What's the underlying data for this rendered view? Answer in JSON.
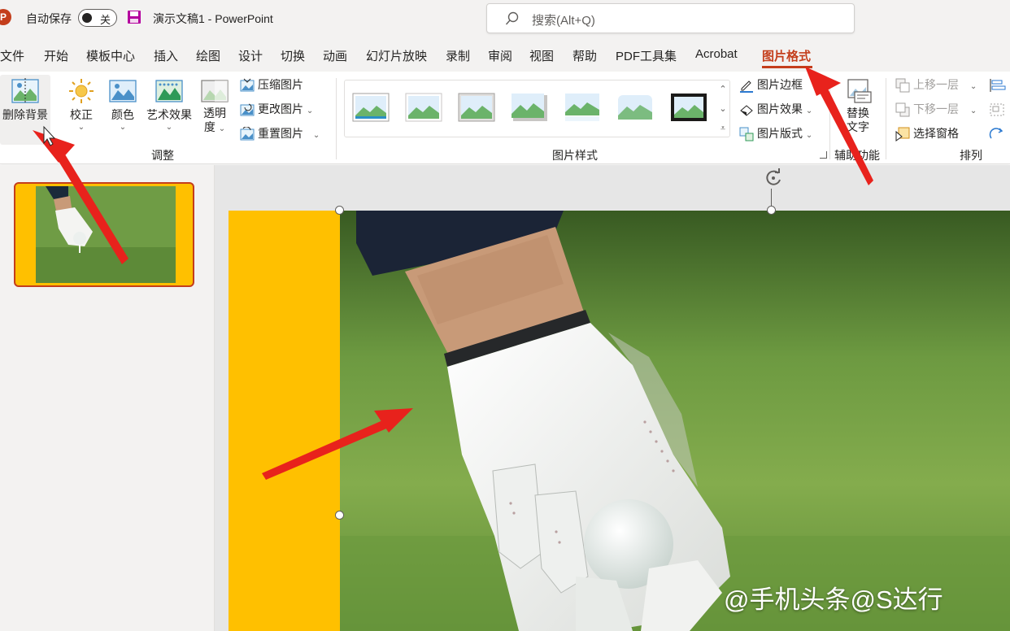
{
  "titlebar": {
    "app_logo": "P",
    "autosave_label": "自动保存",
    "autosave_state": "关",
    "doc_title": "演示文稿1  -  PowerPoint",
    "search_placeholder": "搜索(Alt+Q)"
  },
  "tabs": [
    {
      "label": "文件"
    },
    {
      "label": "开始"
    },
    {
      "label": "模板中心"
    },
    {
      "label": "插入"
    },
    {
      "label": "绘图"
    },
    {
      "label": "设计"
    },
    {
      "label": "切换"
    },
    {
      "label": "动画"
    },
    {
      "label": "幻灯片放映"
    },
    {
      "label": "录制"
    },
    {
      "label": "审阅"
    },
    {
      "label": "视图"
    },
    {
      "label": "帮助"
    },
    {
      "label": "PDF工具集"
    },
    {
      "label": "Acrobat"
    },
    {
      "label": "图片格式",
      "active": true
    }
  ],
  "ribbon": {
    "remove_bg": "删除背景",
    "corrections": "校正",
    "color": "颜色",
    "artistic": "艺术效果",
    "transparency_1": "透明",
    "transparency_2": "度",
    "compress": "压缩图片",
    "change": "更改图片",
    "reset": "重置图片",
    "group_adjust": "调整",
    "group_styles": "图片样式",
    "border": "图片边框",
    "effects": "图片效果",
    "layout": "图片版式",
    "alt_text_1": "替换",
    "alt_text_2": "文字",
    "group_accessibility": "辅助功能",
    "bring_forward": "上移一层",
    "send_backward": "下移一层",
    "selection_pane": "选择窗格",
    "group_arrange": "排列"
  },
  "watermark": "头条@S达行",
  "watermark_prefix": "@手机",
  "colors": {
    "accent": "#c43e1c",
    "slide_bg": "#ffc000",
    "arrow": "#e8221c"
  }
}
